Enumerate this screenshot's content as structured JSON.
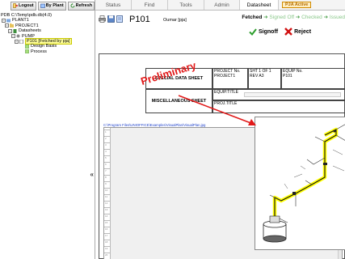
{
  "left_toolbar": {
    "buttons": [
      {
        "label": "Logout",
        "icon": "logout-icon"
      },
      {
        "label": "By Plant",
        "icon": "plant-icon"
      },
      {
        "label": "Refresh",
        "icon": "refresh-icon"
      }
    ]
  },
  "tree": {
    "root": "PDB C:\\Temp\\pdb.db(4.0)",
    "plant": "PLANT1",
    "project": "PROJECT1",
    "datasheets": "Datasheets",
    "pump": "PUMP",
    "doc": "P101 [Fetched by pja]",
    "design_basis": "Design Basis",
    "process": "Process"
  },
  "nav": {
    "tabs": [
      "Status",
      "Find",
      "Tools",
      "Admin",
      "Datasheet"
    ],
    "active_tab": "Datasheet",
    "badge": "PJA Active"
  },
  "header": {
    "doc_name": "P101",
    "doc_user": "Oumar [pja]",
    "workflow": {
      "current": "Fetched",
      "steps": [
        "Signed Off",
        "Checked",
        "Issued"
      ]
    },
    "actions": {
      "signoff": "Signoff",
      "reject": "Reject"
    }
  },
  "datasheet": {
    "title_top": "SPECIAL DATA SHEET",
    "title_bottom": "MISCELLANEOUS SHEET",
    "project_no_label": "PROJECT No.",
    "project_no_value": "PROJECT1",
    "sht_label": "SHT 1 OF 1",
    "rev_label": "REV A3",
    "equip_no_label": "EQUIP No.",
    "equip_no_value": "P101",
    "equip_title_label": "EQUIP.TITLE",
    "proj_title_label": "PROJ.TITLE",
    "watermark": "Preliminary",
    "file_link": "C:\\Program Files\\UNIOFFICE\\Examples\\VisualPlan\\VisualPlan.jpg"
  },
  "colors": {
    "watermark": "#e11919",
    "highlight": "#ffff00",
    "accent_green": "#2e9e2e"
  }
}
